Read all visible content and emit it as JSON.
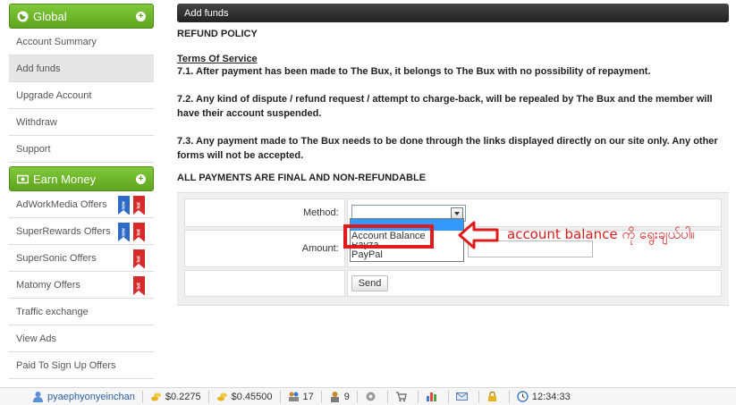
{
  "sidebar": {
    "global_header": "Global",
    "global_items": [
      {
        "label": "Account Summary",
        "active": false
      },
      {
        "label": "Add funds",
        "active": true
      },
      {
        "label": "Upgrade Account",
        "active": false
      },
      {
        "label": "Withdraw",
        "active": false
      },
      {
        "label": "Support",
        "active": false
      }
    ],
    "earn_header": "Earn Money",
    "earn_items": [
      {
        "label": "AdWorkMedia Offers",
        "badges": [
          "new",
          "hot"
        ]
      },
      {
        "label": "SuperRewards Offers",
        "badges": [
          "new",
          "hot"
        ]
      },
      {
        "label": "SuperSonic Offers",
        "badges": [
          "hot"
        ]
      },
      {
        "label": "Matomy Offers",
        "badges": [
          "hot"
        ]
      },
      {
        "label": "Traffic exchange",
        "badges": []
      },
      {
        "label": "View Ads",
        "badges": []
      },
      {
        "label": "Paid To Sign Up Offers",
        "badges": []
      }
    ]
  },
  "main": {
    "bar_title": "Add funds",
    "policy_heading": "REFUND POLICY",
    "tos_title": "Terms Of Service",
    "p1": "7.1. After payment has been made to The Bux, it belongs to The Bux with no possibility of repayment.",
    "p2": "7.2. Any kind of dispute / refund request / attempt to charge-back, will be repealed by The Bux and the member will have their account suspended.",
    "p3": "7.3. Any payment made to The Bux needs to be done through the links displayed directly on our site only. Any other forms will not be accepted.",
    "final_notice": "ALL PAYMENTS ARE FINAL AND NON-REFUNDABLE"
  },
  "form": {
    "method_label": "Method:",
    "amount_label": "Amount:",
    "send_label": "Send",
    "options": [
      "Account Balance",
      "Payza",
      "PayPal"
    ]
  },
  "annotation": {
    "text": "account balance ကို ရွေးချယ်ပါ။",
    "color": "#d81c1c"
  },
  "bottombar": {
    "username": "pyaephyonyeinchan",
    "balance1": "$0.2275",
    "balance2": "$0.45500",
    "count1": "17",
    "count2": "9",
    "time": "12:34:33"
  }
}
